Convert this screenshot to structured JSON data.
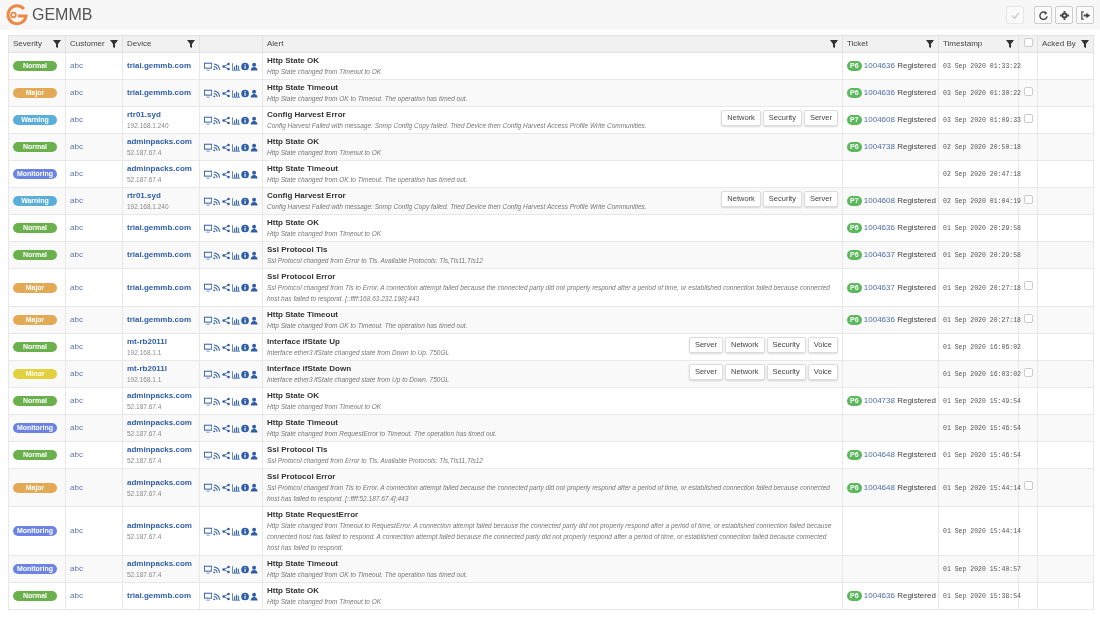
{
  "app": {
    "name": "GEMMB"
  },
  "toolbar": [
    {
      "kind": "check",
      "disabled": true
    },
    {
      "kind": "refresh",
      "disabled": false
    },
    {
      "kind": "settings",
      "disabled": false
    },
    {
      "kind": "logout",
      "disabled": false
    }
  ],
  "table": {
    "columns": [
      {
        "label": "Severity",
        "filter": true
      },
      {
        "label": "Customer",
        "filter": true
      },
      {
        "label": "Device",
        "filter": true
      },
      {
        "filter": false
      },
      {
        "label": "Alert",
        "filter": true
      },
      {
        "label": "Ticket",
        "filter": true
      },
      {
        "label": "Timestamp",
        "filter": true
      },
      {
        "kind": "checkbox",
        "checked": false
      },
      {
        "label": "Acked By",
        "filter": true
      }
    ],
    "rows": [
      {
        "severity": "Normal",
        "color": "#6ab04c",
        "customer": "abc",
        "device": "trial.gemmb.com",
        "title": "Http State OK",
        "description": "Http State changed from Timeout to OK",
        "ticket": {
          "priority": "P6",
          "number": "1004636",
          "status": "Registered"
        },
        "timestamp": "03 Sep 2020 01:33:22"
      },
      {
        "severity": "Major",
        "color": "#e4a954",
        "customer": "abc",
        "device": "trial.gemmb.com",
        "title": "Http State Timeout",
        "description": "Http State changed from OK to Timeout. The operation has timed out.",
        "ticket": {
          "priority": "P6",
          "number": "1004636",
          "status": "Registered"
        },
        "timestamp": "03 Sep 2020 01:30:22",
        "ack": {
          "checked": false
        }
      },
      {
        "severity": "Warning",
        "color": "#5aaed8",
        "customer": "abc",
        "device": "rtr01.syd",
        "address": "192.168.1.240",
        "title": "Config Harvest Error",
        "description": "Config Harvest Failed with message: Snmp Config Copy failed. Tried Device then Config Harvest Access Profile Write Communities.",
        "tags": [
          "Network",
          "Security",
          "Server"
        ],
        "ticket": {
          "priority": "P7",
          "number": "1004608",
          "status": "Registered"
        },
        "timestamp": "03 Sep 2020 01:09:33",
        "ack": {
          "checked": false
        }
      },
      {
        "severity": "Normal",
        "color": "#6ab04c",
        "customer": "abc",
        "device": "adminpacks.com",
        "address": "52.187.67.4",
        "title": "Http State OK",
        "description": "Http State changed from Timeout to OK",
        "ticket": {
          "priority": "P6",
          "number": "1004738",
          "status": "Registered"
        },
        "timestamp": "02 Sep 2020 20:50:18"
      },
      {
        "severity": "Monitoring",
        "color": "#6b83e6",
        "customer": "abc",
        "device": "adminpacks.com",
        "address": "52.187.67.4",
        "title": "Http State Timeout",
        "description": "Http State changed from OK to Timeout. The operation has timed out.",
        "timestamp": "02 Sep 2020 20:47:18"
      },
      {
        "severity": "Warning",
        "color": "#5aaed8",
        "customer": "abc",
        "device": "rtr01.syd",
        "address": "192.168.1.240",
        "title": "Config Harvest Error",
        "description": "Config Harvest Failed with message: Snmp Config Copy failed. Tried Device then Config Harvest Access Profile Write Communities.",
        "tags": [
          "Network",
          "Security",
          "Server"
        ],
        "ticket": {
          "priority": "P7",
          "number": "1004608",
          "status": "Registered"
        },
        "timestamp": "02 Sep 2020 01:04:19",
        "ack": {
          "checked": false
        }
      },
      {
        "severity": "Normal",
        "color": "#6ab04c",
        "customer": "abc",
        "device": "trial.gemmb.com",
        "title": "Http State OK",
        "description": "Http State changed from Timeout to OK",
        "ticket": {
          "priority": "P6",
          "number": "1004636",
          "status": "Registered"
        },
        "timestamp": "01 Sep 2020 20:29:58"
      },
      {
        "severity": "Normal",
        "color": "#6ab04c",
        "customer": "abc",
        "device": "trial.gemmb.com",
        "title": "Ssl Protocol Tls",
        "description": "Ssl Protocol changed from Error to Tls. Available Protocols: Tls,Tls11,Tls12",
        "ticket": {
          "priority": "P6",
          "number": "1004637",
          "status": "Registered"
        },
        "timestamp": "01 Sep 2020 20:29:58"
      },
      {
        "severity": "Major",
        "color": "#e4a954",
        "customer": "abc",
        "device": "trial.gemmb.com",
        "title": "Ssl Protocol Error",
        "description": "Ssl Protocol changed from Tls to Error. A connection attempt failed because the connected party did not properly respond after a period of time, or established connection failed because connected host has failed to respond. [::ffff:168.63.232.198]:443",
        "ticket": {
          "priority": "P6",
          "number": "1004637",
          "status": "Registered"
        },
        "timestamp": "01 Sep 2020 20:27:18",
        "ack": {
          "checked": false
        }
      },
      {
        "severity": "Major",
        "color": "#e4a954",
        "customer": "abc",
        "device": "trial.gemmb.com",
        "title": "Http State Timeout",
        "description": "Http State changed from OK to Timeout. The operation has timed out.",
        "ticket": {
          "priority": "P6",
          "number": "1004636",
          "status": "Registered"
        },
        "timestamp": "01 Sep 2020 20:27:18",
        "ack": {
          "checked": false
        }
      },
      {
        "severity": "Normal",
        "color": "#6ab04c",
        "customer": "abc",
        "device": "mt-rb2011l",
        "address": "192.168.1.1",
        "title": "Interface ifState Up",
        "description": "Interface ether3 ifState changed state from Down to Up. 750GL",
        "tags": [
          "Server",
          "Network",
          "Security",
          "Voice"
        ],
        "timestamp": "01 Sep 2020 16:06:02"
      },
      {
        "severity": "Minor",
        "color": "#e2d03c",
        "customer": "abc",
        "device": "mt-rb2011l",
        "address": "192.168.1.1",
        "title": "Interface ifState Down",
        "description": "Interface ether3 ifState changed state from Up to Down. 750GL",
        "tags": [
          "Server",
          "Network",
          "Security",
          "Voice"
        ],
        "timestamp": "01 Sep 2020 16:03:02",
        "ack": {
          "checked": false
        }
      },
      {
        "severity": "Normal",
        "color": "#6ab04c",
        "customer": "abc",
        "device": "adminpacks.com",
        "address": "52.187.67.4",
        "title": "Http State OK",
        "description": "Http State changed from Timeout to OK",
        "ticket": {
          "priority": "P6",
          "number": "1004738",
          "status": "Registered"
        },
        "timestamp": "01 Sep 2020 15:49:54"
      },
      {
        "severity": "Monitoring",
        "color": "#6b83e6",
        "customer": "abc",
        "device": "adminpacks.com",
        "address": "52.187.67.4",
        "title": "Http State Timeout",
        "description": "Http State changed from RequestError to Timeout. The operation has timed out.",
        "timestamp": "01 Sep 2020 15:46:54"
      },
      {
        "severity": "Normal",
        "color": "#6ab04c",
        "customer": "abc",
        "device": "adminpacks.com",
        "address": "52.187.67.4",
        "title": "Ssl Protocol Tls",
        "description": "Ssl Protocol changed from Error to Tls. Available Protocols: Tls,Tls11,Tls12",
        "ticket": {
          "priority": "P6",
          "number": "1004648",
          "status": "Registered"
        },
        "timestamp": "01 Sep 2020 15:46:54"
      },
      {
        "severity": "Major",
        "color": "#e4a954",
        "customer": "abc",
        "device": "adminpacks.com",
        "address": "52.187.67.4",
        "title": "Ssl Protocol Error",
        "description": "Ssl Protocol changed from Tls to Error. A connection attempt failed because the connected party did not properly respond after a period of time, or established connection failed because connected host has failed to respond. [::ffff:52.187.67.4]:443",
        "ticket": {
          "priority": "P6",
          "number": "1004648",
          "status": "Registered"
        },
        "timestamp": "01 Sep 2020 15:44:14",
        "ack": {
          "checked": false
        }
      },
      {
        "severity": "Monitoring",
        "color": "#6b83e6",
        "customer": "abc",
        "device": "adminpacks.com",
        "address": "52.187.67.4",
        "title": "Http State RequestError",
        "description": "Http State changed from Timeout to RequestError. A connection attempt failed because the connected party did not properly respond after a period of time, or established connection failed because connected host has failed to respond. A connection attempt failed because the connected party did not properly respond after a period of time, or established connection failed because connected host has failed to respond.",
        "timestamp": "01 Sep 2020 15:44:14"
      },
      {
        "severity": "Monitoring",
        "color": "#6b83e6",
        "customer": "abc",
        "device": "adminpacks.com",
        "address": "52.187.67.4",
        "title": "Http State Timeout",
        "description": "Http State changed from OK to Timeout. The operation has timed out.",
        "timestamp": "01 Sep 2020 15:40:57"
      },
      {
        "severity": "Normal",
        "color": "#6ab04c",
        "customer": "abc",
        "device": "trial.gemmb.com",
        "title": "Http State OK",
        "description": "Http State changed from Timeout to OK",
        "ticket": {
          "priority": "P6",
          "number": "1004636",
          "status": "Registered"
        },
        "timestamp": "01 Sep 2020 15:38:54"
      }
    ]
  }
}
